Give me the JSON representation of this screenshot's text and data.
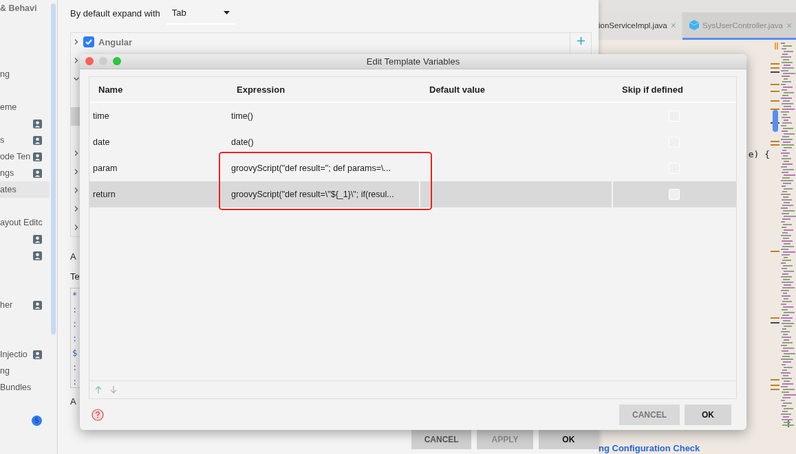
{
  "sidebar": {
    "items": [
      {
        "kind": "heading",
        "label": "& Behavi"
      },
      {
        "kind": "spacer"
      },
      {
        "kind": "spacer"
      },
      {
        "kind": "spacer"
      },
      {
        "kind": "item",
        "label": "ng",
        "person_icon": false,
        "selected": false
      },
      {
        "kind": "spacer"
      },
      {
        "kind": "item",
        "label": "eme",
        "person_icon": false,
        "selected": false
      },
      {
        "kind": "item",
        "person_icon": true,
        "selected": false
      },
      {
        "kind": "item",
        "label": "s",
        "person_icon": true,
        "selected": false
      },
      {
        "kind": "item",
        "label": "ode Ten",
        "person_icon": true,
        "selected": false
      },
      {
        "kind": "item",
        "label": "ngs",
        "person_icon": true,
        "selected": false
      },
      {
        "kind": "item",
        "label": "ates",
        "person_icon": false,
        "selected": true
      },
      {
        "kind": "spacer"
      },
      {
        "kind": "item",
        "label": "ayout Editc",
        "person_icon": false,
        "selected": false
      },
      {
        "kind": "item",
        "person_icon": true,
        "selected": false
      },
      {
        "kind": "item",
        "person_icon": true,
        "selected": false
      },
      {
        "kind": "spacer"
      },
      {
        "kind": "spacer"
      },
      {
        "kind": "item",
        "label": "her",
        "person_icon": true,
        "selected": false
      },
      {
        "kind": "spacer"
      },
      {
        "kind": "spacer"
      },
      {
        "kind": "item",
        "label": "Injectio",
        "person_icon": true,
        "selected": false
      },
      {
        "kind": "item",
        "label": "ng",
        "person_icon": false,
        "selected": false
      },
      {
        "kind": "item",
        "label": "Bundles",
        "person_icon": false,
        "selected": false
      },
      {
        "kind": "spacer"
      },
      {
        "kind": "badge",
        "label": "5"
      }
    ]
  },
  "settings": {
    "expand_label": "By default expand with",
    "expand_value": "Tab",
    "tree": [
      {
        "expanded": false,
        "checked": true,
        "label": "Angular"
      },
      {
        "expanded": false
      },
      {
        "expanded": true,
        "children": [
          {
            "selected": false
          },
          {
            "selected": true
          },
          {
            "selected": false
          }
        ]
      },
      {
        "expanded": false
      },
      {
        "expanded": false
      },
      {
        "expanded": false
      },
      {
        "expanded": false
      },
      {
        "expanded": false
      }
    ],
    "section_label": "A",
    "template_label": "Te",
    "template_lines": [
      "*",
      ":",
      ":",
      ":",
      "$",
      ":",
      ":"
    ],
    "section_label_2": "A",
    "buttons": [
      {
        "label": "CANCEL",
        "disabled": false
      },
      {
        "label": "APPLY",
        "disabled": true
      },
      {
        "label": "OK",
        "disabled": false
      }
    ]
  },
  "editor": {
    "tabs": [
      {
        "label": "ionServiceImpl.java",
        "close": "×",
        "file_icon": false,
        "selected": false
      },
      {
        "label": "SysUserController.java",
        "close": "×",
        "file_icon": true,
        "selected": true
      }
    ],
    "code_lines": [
      "e) {"
    ],
    "status_link": "ng Configuration Check"
  },
  "dialog": {
    "title": "Edit Template Variables",
    "columns": [
      "Name",
      "Expression",
      "Default value",
      "Skip if defined"
    ],
    "rows": [
      {
        "name": "time",
        "expression": "time()",
        "skip_if_defined": false,
        "selected": false
      },
      {
        "name": "date",
        "expression": "date()",
        "skip_if_defined": false,
        "selected": false
      },
      {
        "name": "param",
        "expression": "groovyScript(\"def result=\"; def params=\\...",
        "skip_if_defined": false,
        "selected": false
      },
      {
        "name": "return",
        "expression": "groovyScript(\"def result=\\\"${_1}\\\"; if(resul...",
        "skip_if_defined": false,
        "selected": true
      }
    ],
    "buttons": [
      {
        "label": "CANCEL",
        "kind": "secondary"
      },
      {
        "label": "OK",
        "kind": "primary"
      }
    ]
  }
}
